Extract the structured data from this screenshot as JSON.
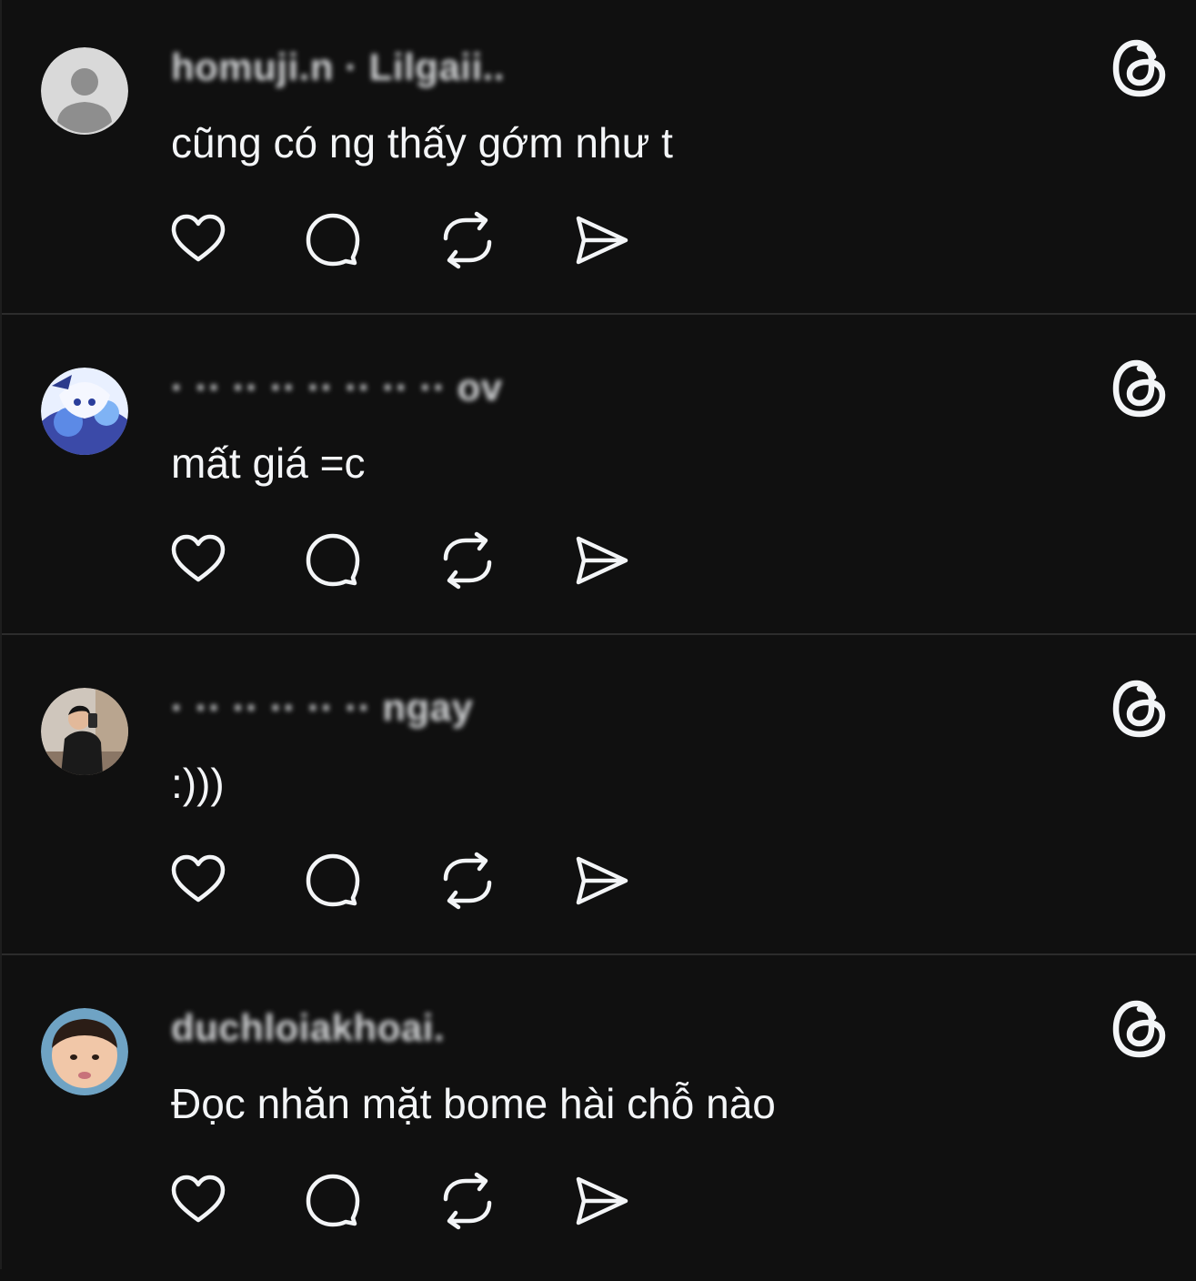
{
  "posts": [
    {
      "username": "homuji.n · Lilgaii..",
      "text": "cũng có ng thấy gớm như t",
      "avatar_kind": "default"
    },
    {
      "username": "· ·· ·· ·· ·· ·· ·· ·· ov",
      "text": "mất giá =c",
      "avatar_kind": "anime"
    },
    {
      "username": "· ·· ·· ·· ·· ·· ngay",
      "text": ":)))",
      "avatar_kind": "mirror-selfie"
    },
    {
      "username": "duchloiakhoai.",
      "text": "Đọc nhăn mặt bome hài chỗ nào",
      "avatar_kind": "child"
    }
  ],
  "icons": {
    "like": "heart-icon",
    "reply": "comment-bubble-icon",
    "repost": "repost-icon",
    "share": "send-icon",
    "brand": "threads-logo-icon"
  },
  "colors": {
    "background": "#101010",
    "text": "#f3f5f7",
    "divider": "#2c2c2c"
  }
}
